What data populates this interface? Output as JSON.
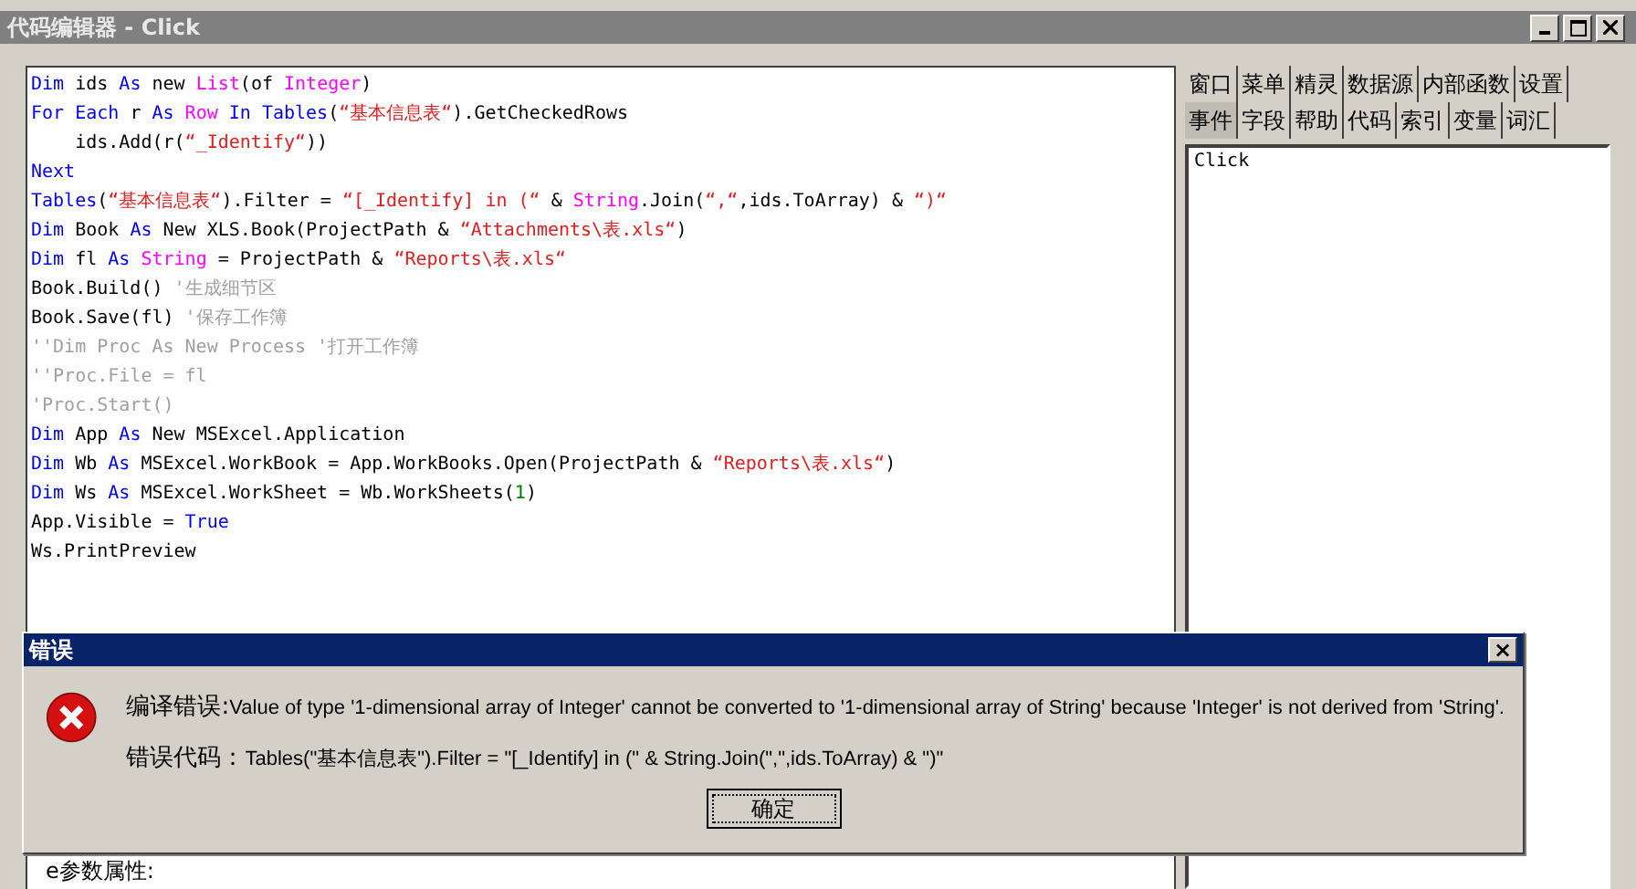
{
  "window": {
    "title": "代码编辑器 - Click"
  },
  "code_lines": [
    [
      {
        "text": "Dim",
        "kind": "keyword"
      },
      {
        "text": " ids ",
        "kind": "plain"
      },
      {
        "text": "As",
        "kind": "keyword"
      },
      {
        "text": " new ",
        "kind": "plain"
      },
      {
        "text": "List",
        "kind": "type"
      },
      {
        "text": "(of ",
        "kind": "plain"
      },
      {
        "text": "Integer",
        "kind": "type"
      },
      {
        "text": ")",
        "kind": "plain"
      }
    ],
    [
      {
        "text": "For Each",
        "kind": "keyword"
      },
      {
        "text": " r ",
        "kind": "plain"
      },
      {
        "text": "As",
        "kind": "keyword"
      },
      {
        "text": " Row",
        "kind": "type"
      },
      {
        "text": " In Tables",
        "kind": "keyword"
      },
      {
        "text": "(",
        "kind": "plain"
      },
      {
        "text": "“基本信息表“",
        "kind": "string"
      },
      {
        "text": ").GetCheckedRows",
        "kind": "plain"
      }
    ],
    [
      {
        "text": "    ids.Add(r(",
        "kind": "plain"
      },
      {
        "text": "“_Identify“",
        "kind": "string"
      },
      {
        "text": "))",
        "kind": "plain"
      }
    ],
    [
      {
        "text": "Next",
        "kind": "keyword"
      }
    ],
    [
      {
        "text": "Tables",
        "kind": "keyword"
      },
      {
        "text": "(",
        "kind": "plain"
      },
      {
        "text": "“基本信息表“",
        "kind": "string"
      },
      {
        "text": ").Filter = ",
        "kind": "plain"
      },
      {
        "text": "“[_Identify] in (“",
        "kind": "string"
      },
      {
        "text": " & ",
        "kind": "plain"
      },
      {
        "text": "String",
        "kind": "type"
      },
      {
        "text": ".Join(",
        "kind": "plain"
      },
      {
        "text": "“,“",
        "kind": "string"
      },
      {
        "text": ",ids.ToArray) & ",
        "kind": "plain"
      },
      {
        "text": "“)“",
        "kind": "string"
      }
    ],
    [
      {
        "text": "Dim",
        "kind": "keyword"
      },
      {
        "text": " Book ",
        "kind": "plain"
      },
      {
        "text": "As",
        "kind": "keyword"
      },
      {
        "text": " New XLS.Book(ProjectPath & ",
        "kind": "plain"
      },
      {
        "text": "“Attachments\\表.xls“",
        "kind": "string"
      },
      {
        "text": ")",
        "kind": "plain"
      }
    ],
    [
      {
        "text": "Dim",
        "kind": "keyword"
      },
      {
        "text": " fl ",
        "kind": "plain"
      },
      {
        "text": "As",
        "kind": "keyword"
      },
      {
        "text": " String",
        "kind": "type"
      },
      {
        "text": " = ProjectPath & ",
        "kind": "plain"
      },
      {
        "text": "“Reports\\表.xls“",
        "kind": "string"
      }
    ],
    [
      {
        "text": "Book.Build() ",
        "kind": "plain"
      },
      {
        "text": "'生成细节区",
        "kind": "comment"
      }
    ],
    [
      {
        "text": "Book.Save(fl) ",
        "kind": "plain"
      },
      {
        "text": "'保存工作簿",
        "kind": "comment"
      }
    ],
    [
      {
        "text": "''Dim Proc As New Process '打开工作簿",
        "kind": "comment"
      }
    ],
    [
      {
        "text": "''Proc.File = fl",
        "kind": "comment"
      }
    ],
    [
      {
        "text": "'Proc.Start()",
        "kind": "comment"
      }
    ],
    [
      {
        "text": "Dim",
        "kind": "keyword"
      },
      {
        "text": " App ",
        "kind": "plain"
      },
      {
        "text": "As",
        "kind": "keyword"
      },
      {
        "text": " New MSExcel.Application",
        "kind": "plain"
      }
    ],
    [
      {
        "text": "Dim",
        "kind": "keyword"
      },
      {
        "text": " Wb ",
        "kind": "plain"
      },
      {
        "text": "As",
        "kind": "keyword"
      },
      {
        "text": " MSExcel.WorkBook = App.WorkBooks.Open(ProjectPath & ",
        "kind": "plain"
      },
      {
        "text": "“Reports\\表.xls“",
        "kind": "string"
      },
      {
        "text": ")",
        "kind": "plain"
      }
    ],
    [
      {
        "text": "Dim",
        "kind": "keyword"
      },
      {
        "text": " Ws ",
        "kind": "plain"
      },
      {
        "text": "As",
        "kind": "keyword"
      },
      {
        "text": " MSExcel.WorkSheet = Wb.WorkSheets(",
        "kind": "plain"
      },
      {
        "text": "1",
        "kind": "number"
      },
      {
        "text": ")",
        "kind": "plain"
      }
    ],
    [
      {
        "text": "App.Visible = ",
        "kind": "plain"
      },
      {
        "text": "True",
        "kind": "keyword"
      }
    ],
    [
      {
        "text": "Ws.PrintPreview",
        "kind": "plain"
      }
    ]
  ],
  "params_label": "e参数属性:",
  "side_tabs_row1": [
    {
      "label": "窗口",
      "selected": false
    },
    {
      "label": "菜单",
      "selected": false
    },
    {
      "label": "精灵",
      "selected": false
    },
    {
      "label": "数据源",
      "selected": false
    },
    {
      "label": "内部函数",
      "selected": false
    },
    {
      "label": "设置",
      "selected": false
    }
  ],
  "side_tabs_row2": [
    {
      "label": "事件",
      "selected": true
    },
    {
      "label": "字段",
      "selected": false
    },
    {
      "label": "帮助",
      "selected": false
    },
    {
      "label": "代码",
      "selected": false
    },
    {
      "label": "索引",
      "selected": false
    },
    {
      "label": "变量",
      "selected": false
    },
    {
      "label": "词汇",
      "selected": false
    }
  ],
  "side_list": [
    "Click"
  ],
  "dialog": {
    "title": "错误",
    "close": "×",
    "message_label": "编译错误:",
    "message": "Value of type '1-dimensional array of Integer' cannot be converted to '1-dimensional array of String' because 'Integer' is not derived from 'String'.",
    "code_label": "错误代码：",
    "code": "Tables(\"基本信息表\").Filter = \"[_Identify] in (\" & String.Join(\",\",ids.ToArray) & \")\"",
    "ok": "确定"
  }
}
